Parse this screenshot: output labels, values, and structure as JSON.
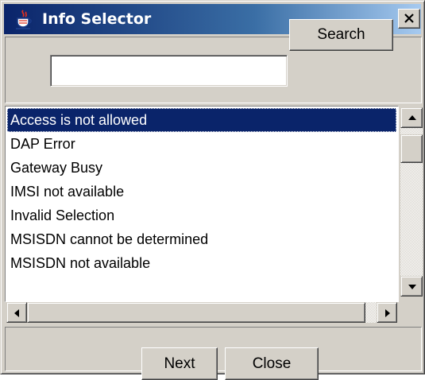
{
  "window": {
    "title": "Info Selector",
    "icon": "java-cup-icon",
    "close_glyph": "close-x-icon"
  },
  "search": {
    "input_value": "",
    "button_label": "Search"
  },
  "list": {
    "selected_index": 0,
    "items": [
      "Access is not allowed",
      "DAP Error",
      "Gateway Busy",
      "IMSI not available",
      "Invalid Selection",
      "MSISDN cannot be determined",
      "MSISDN not available"
    ]
  },
  "footer": {
    "next_label": "Next",
    "close_label": "Close"
  },
  "colors": {
    "titlebar_start": "#0a246a",
    "titlebar_end": "#a6caf0",
    "selection": "#0a246a",
    "face": "#d4d0c8"
  }
}
